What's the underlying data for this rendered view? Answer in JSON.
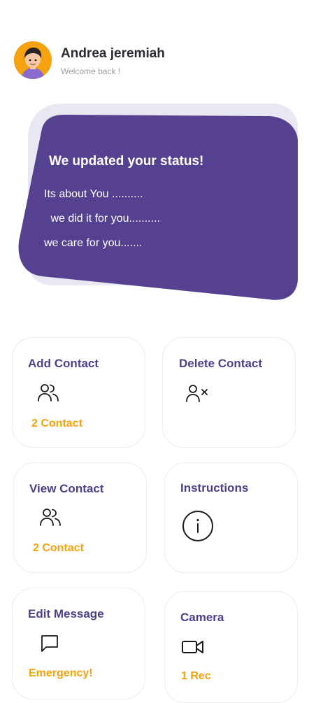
{
  "user": {
    "name": "Andrea jeremiah",
    "greeting": "Welcome back !",
    "avatar_icon": "user-avatar-icon"
  },
  "status_banner": {
    "title": "We updated your  status!",
    "lines": [
      "Its about You ..........",
      " we did it for you..........",
      "we care for you......."
    ],
    "color": "#55418F"
  },
  "cards": [
    {
      "title": "Add Contact",
      "icon": "users-icon",
      "subtitle": "2 Contact"
    },
    {
      "title": "Delete Contact",
      "icon": "user-remove-icon"
    },
    {
      "title": "View Contact",
      "icon": "users-icon",
      "subtitle": "2 Contact"
    },
    {
      "title": "Instructions",
      "icon": "info-icon"
    },
    {
      "title": "Edit Message",
      "icon": "message-square-icon",
      "subtitle": "Emergency!"
    },
    {
      "title": "Camera",
      "icon": "video-icon",
      "subtitle": "1 Rec"
    }
  ],
  "colors": {
    "accent": "#F5A20E",
    "primary": "#4E3F8A",
    "banner_shadow": "#E9E8F2"
  }
}
